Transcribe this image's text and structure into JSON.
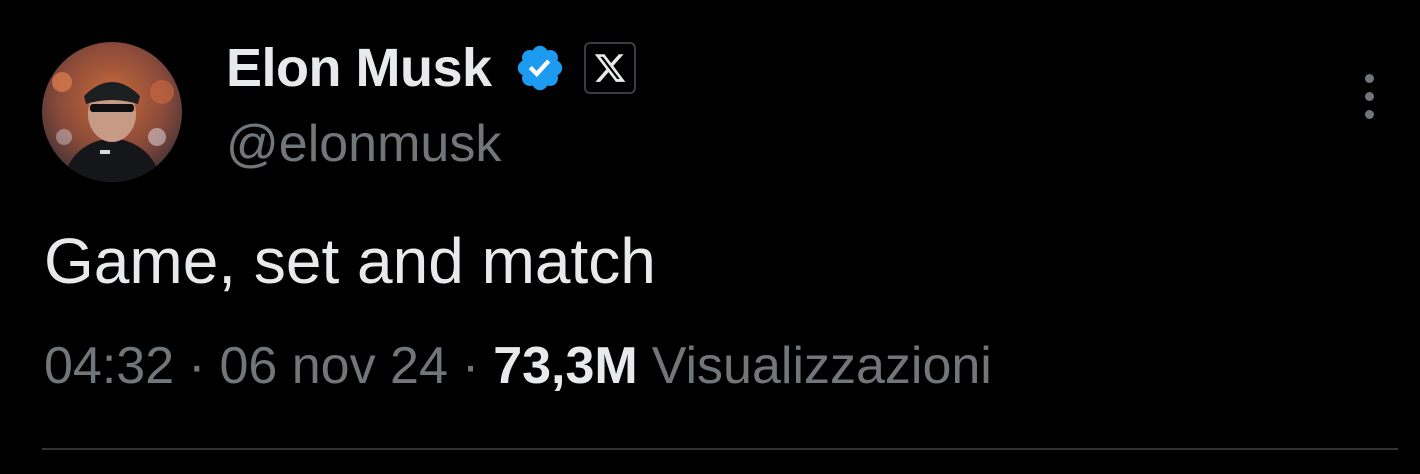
{
  "author": {
    "display_name": "Elon Musk",
    "handle": "@elonmusk",
    "verified_icon": "verified-badge-icon",
    "affiliation_icon": "x-logo-icon",
    "badge_color": "#1d9bf0"
  },
  "tweet": {
    "text": "Game, set and match"
  },
  "meta": {
    "time": "04:32",
    "separator": "·",
    "date": "06 nov 24",
    "views_count": "73,3M",
    "views_label": "Visualizzazioni"
  },
  "menu": {
    "icon": "more-vertical-icon"
  },
  "colors": {
    "background": "#000000",
    "primary_text": "#e7e9ea",
    "secondary_text": "#71767b",
    "divider": "#2f3336"
  }
}
